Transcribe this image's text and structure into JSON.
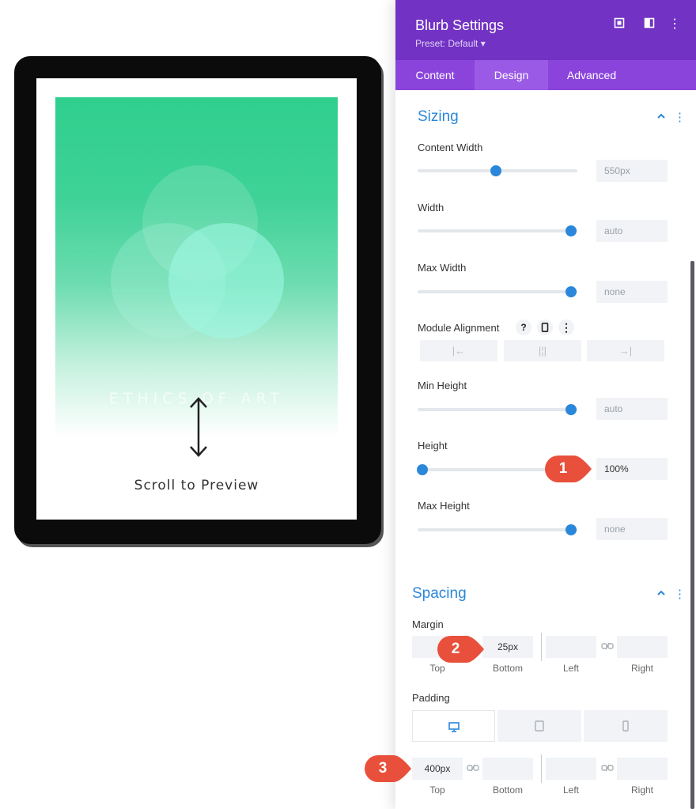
{
  "preview": {
    "art_title": "ETHICS OF ART",
    "scroll_label": "Scroll to Preview"
  },
  "panel": {
    "title": "Blurb Settings",
    "preset": "Preset: Default ▾",
    "tabs": [
      "Content",
      "Design",
      "Advanced"
    ],
    "active_tab": "Design"
  },
  "sizing": {
    "title": "Sizing",
    "content_width": {
      "label": "Content Width",
      "value": "550px",
      "level": 0.49
    },
    "width": {
      "label": "Width",
      "value": "auto",
      "level": 0.96
    },
    "max_width": {
      "label": "Max Width",
      "value": "none",
      "level": 0.96
    },
    "module_alignment": {
      "label": "Module Alignment"
    },
    "min_height": {
      "label": "Min Height",
      "value": "auto",
      "level": 0.96
    },
    "height": {
      "label": "Height",
      "value": "100%",
      "level": 0.03
    },
    "max_height": {
      "label": "Max Height",
      "value": "none",
      "level": 0.96
    }
  },
  "spacing": {
    "title": "Spacing",
    "margin": {
      "label": "Margin",
      "bottom_value": "25px",
      "labels": [
        "Top",
        "Bottom",
        "Left",
        "Right"
      ]
    },
    "padding": {
      "label": "Padding",
      "top_value": "400px",
      "labels": [
        "Top",
        "Bottom",
        "Left",
        "Right"
      ]
    }
  },
  "callouts": [
    "1",
    "2",
    "3"
  ],
  "colors": {
    "accent": "#2b87da",
    "header_purple": "#7232c4",
    "tab_purple": "#8a44dc",
    "callout_red": "#e8503c",
    "art_green": "#2fcf8e"
  },
  "icons": [
    "fullscreen-icon",
    "split-view-icon",
    "more-icon",
    "chevron-up-icon",
    "help-icon",
    "mobile-icon",
    "link-icon",
    "desktop-icon",
    "tablet-icon",
    "phone-icon",
    "align-left-icon",
    "align-center-icon",
    "align-right-icon",
    "up-down-arrow-icon"
  ]
}
